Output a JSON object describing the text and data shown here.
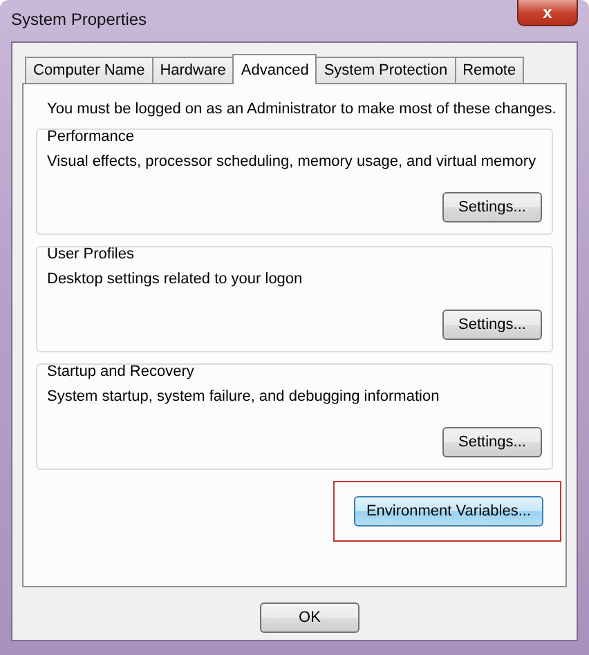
{
  "window": {
    "title": "System Properties",
    "close": "x"
  },
  "tabs": [
    {
      "label": "Computer Name",
      "selected": false
    },
    {
      "label": "Hardware",
      "selected": false
    },
    {
      "label": "Advanced",
      "selected": true
    },
    {
      "label": "System Protection",
      "selected": false
    },
    {
      "label": "Remote",
      "selected": false
    }
  ],
  "notice": "You must be logged on as an Administrator to make most of these changes.",
  "groups": [
    {
      "title": "Performance",
      "description": "Visual effects, processor scheduling, memory usage, and virtual memory",
      "button": "Settings..."
    },
    {
      "title": "User Profiles",
      "description": "Desktop settings related to your logon",
      "button": "Settings..."
    },
    {
      "title": "Startup and Recovery",
      "description": "System startup, system failure, and debugging information",
      "button": "Settings..."
    }
  ],
  "env_button": {
    "label": "Environment Variables...",
    "highlighted": true
  },
  "buttons": [
    "OK"
  ]
}
